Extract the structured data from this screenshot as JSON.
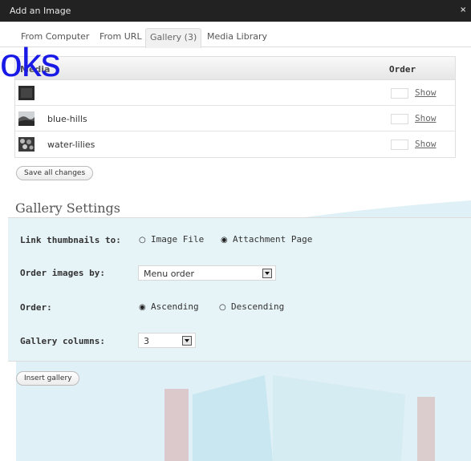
{
  "window": {
    "title": "Add an Image",
    "close_icon": "×"
  },
  "tabs": [
    {
      "label": "From Computer",
      "active": false
    },
    {
      "label": "From URL",
      "active": false
    },
    {
      "label": "Gallery (3)",
      "active": true
    },
    {
      "label": "Media Library",
      "active": false
    }
  ],
  "overlay": {
    "text": "oks"
  },
  "media_table": {
    "header_media": "Media",
    "header_order": "Order",
    "rows": [
      {
        "name": "",
        "order": "",
        "show": "Show",
        "thumb": "dark"
      },
      {
        "name": "blue-hills",
        "order": "",
        "show": "Show",
        "thumb": "hills"
      },
      {
        "name": "water-lilies",
        "order": "",
        "show": "Show",
        "thumb": "lilies"
      }
    ]
  },
  "buttons": {
    "save_all": "Save all changes",
    "insert_gallery": "Insert gallery"
  },
  "gallery_settings": {
    "title": "Gallery Settings",
    "link_thumbnails_label": "Link thumbnails to:",
    "link_options": [
      "Image File",
      "Attachment Page"
    ],
    "link_selected": "Attachment Page",
    "order_by_label": "Order images by:",
    "order_by_value": "Menu order",
    "order_label": "Order:",
    "order_options": [
      "Ascending",
      "Descending"
    ],
    "order_selected": "Ascending",
    "columns_label": "Gallery columns:",
    "columns_value": "3"
  },
  "glyphs": {
    "radio_on": "◉",
    "radio_off": "○"
  },
  "colors": {
    "titlebar": "#222222",
    "panel_bg": "#e6f3f7",
    "overlay_text": "#1a1ae6",
    "art_red": "#c9a2a2",
    "art_blue": "#cfe8f0"
  }
}
